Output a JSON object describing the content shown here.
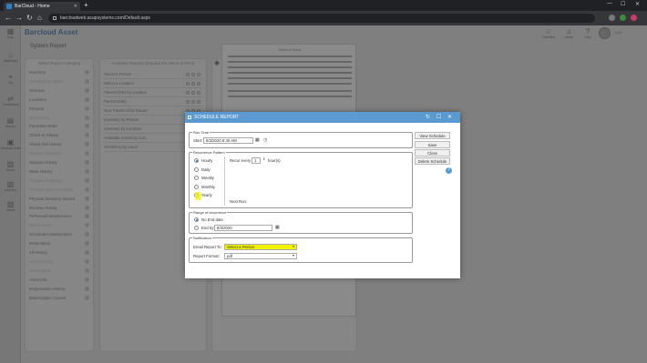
{
  "browser": {
    "tab_title": "BarCloud - Home",
    "tab_close": "✕",
    "new_tab": "+",
    "url": "barcloudweb.acapsystems.com/Default.aspx",
    "back": "←",
    "forward": "→",
    "reload": "↻",
    "home": "⌂",
    "minimize": "—",
    "maximize": "☐",
    "close": "✕"
  },
  "app": {
    "brand": "Barcloud Asset",
    "page_title": "System Report",
    "rail": [
      {
        "icon": "grid-icon",
        "label": "Apps"
      },
      {
        "icon": "home-icon",
        "label": "Dashboard"
      },
      {
        "icon": "tag-icon",
        "label": "Tag"
      },
      {
        "icon": "transactions-icon",
        "label": "Transactions"
      },
      {
        "icon": "reports-icon",
        "label": "Reports"
      },
      {
        "icon": "schedule-icon",
        "label": "Schedule Stats"
      },
      {
        "icon": "library-icon",
        "label": "Library"
      },
      {
        "icon": "inventory-icon",
        "label": "Inventory"
      },
      {
        "icon": "assets-icon",
        "label": "Assets"
      }
    ],
    "header_icons": [
      {
        "icon": "favorites-icon",
        "label": "Favorites"
      },
      {
        "icon": "alerts-icon",
        "label": "Alerts"
      },
      {
        "icon": "help-icon",
        "label": "Help"
      }
    ],
    "username": "ACE"
  },
  "left_panel": {
    "title": "Select Report Category",
    "items": [
      {
        "label": "Inventory",
        "dim": false
      },
      {
        "label": "Inventory by Status",
        "dim": true
      },
      {
        "label": "Overdue",
        "dim": false
      },
      {
        "label": "Locations",
        "dim": false
      },
      {
        "label": "Persons",
        "dim": false
      },
      {
        "label": "Purchasing",
        "dim": true
      },
      {
        "label": "Purchase Order",
        "dim": false
      },
      {
        "label": "Check In History",
        "dim": false
      },
      {
        "label": "Check Out History",
        "dim": false
      },
      {
        "label": "Dispose Statistics",
        "dim": true
      },
      {
        "label": "Dispose History",
        "dim": false
      },
      {
        "label": "Move History",
        "dim": false
      },
      {
        "label": "Physical Inventory",
        "dim": true
      },
      {
        "label": "Physical Inventory Detail",
        "dim": true
      },
      {
        "label": "Physical Inventory Moved",
        "dim": false
      },
      {
        "label": "Receive History",
        "dim": false
      },
      {
        "label": "Performed Maintenance",
        "dim": false
      },
      {
        "label": "Maintenance",
        "dim": true
      },
      {
        "label": "Scheduled Maintenance",
        "dim": false
      },
      {
        "label": "Reservation",
        "dim": false
      },
      {
        "label": "All History",
        "dim": false
      },
      {
        "label": "Asset History",
        "dim": true
      },
      {
        "label": "Asset Value",
        "dim": true
      },
      {
        "label": "Asset Info",
        "dim": false
      },
      {
        "label": "Depreciation History",
        "dim": false
      },
      {
        "label": "Depreciation Current",
        "dim": false
      }
    ]
  },
  "mid_panel": {
    "title": "Available Reports (Expand the Same to Print)",
    "items": [
      "Select a Person",
      "Select a Location",
      "Parent-Child by Location",
      "Parent-Child",
      "New Parent-Child Report",
      "Inventory by Person",
      "Inventory by Location",
      "Available Assets by Cat...",
      "All History by Asset"
    ]
  },
  "preview": {
    "title": "Select a Person"
  },
  "modal": {
    "title": "SCHEDULE REPORT",
    "run_time": {
      "legend": "Run Time",
      "start_label": "Start:",
      "start_value": "8/3/2020 8:40 AM"
    },
    "recurrence": {
      "legend": "Recurrence Pattern",
      "options": [
        "Hourly",
        "Daily",
        "Weekly",
        "Monthly",
        "Yearly"
      ],
      "selected": 0,
      "recur_label": "Recur every",
      "recur_value": "1",
      "recur_unit": "hour(s)",
      "next_run_label": "Next Run:"
    },
    "range": {
      "legend": "Range of recurrence",
      "no_end": "No End date",
      "end_by": "End by:",
      "end_value": "8/3/2020"
    },
    "notification": {
      "legend": "Notification",
      "email_label": "Email Report To:",
      "email_value": "Select a Person",
      "format_label": "Report Format:",
      "format_value": "pdf"
    },
    "buttons": [
      "View Schedule",
      "Save",
      "Close",
      "Delete Schedule"
    ],
    "help": "?",
    "ctl_refresh": "↻",
    "ctl_max": "☐",
    "ctl_close": "✕"
  }
}
